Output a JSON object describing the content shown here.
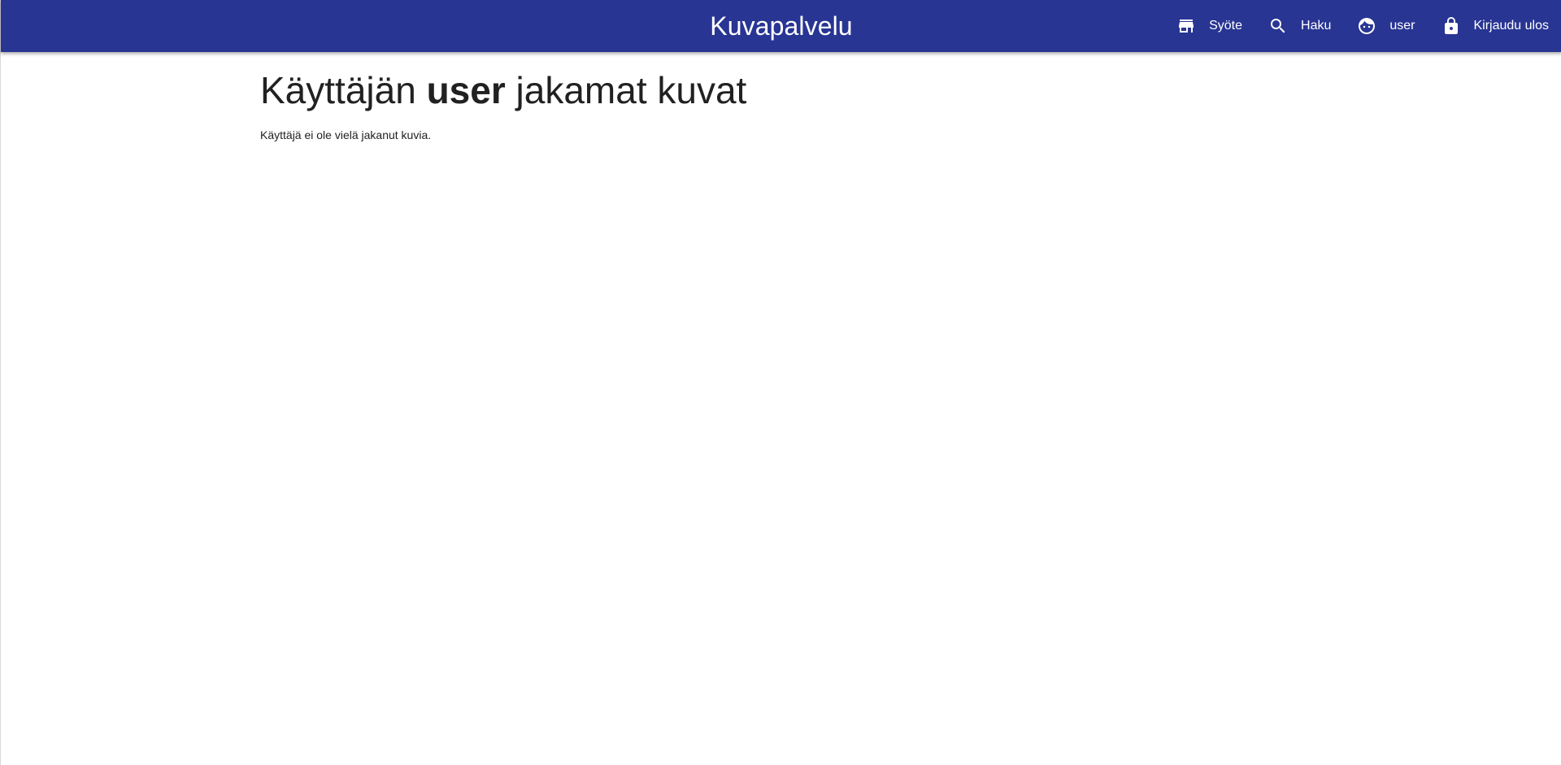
{
  "app": {
    "title": "Kuvapalvelu",
    "accent_color": "#283593"
  },
  "nav": {
    "items": [
      {
        "label": "Syöte",
        "icon": "store-icon"
      },
      {
        "label": "Haku",
        "icon": "search-icon"
      },
      {
        "label": "user",
        "icon": "face-icon"
      },
      {
        "label": "Kirjaudu ulos",
        "icon": "lock-icon"
      }
    ]
  },
  "main": {
    "title_prefix": "Käyttäjän",
    "title_user": "user",
    "title_suffix": "jakamat kuvat",
    "empty_message": "Käyttäjä ei ole vielä jakanut kuvia."
  }
}
